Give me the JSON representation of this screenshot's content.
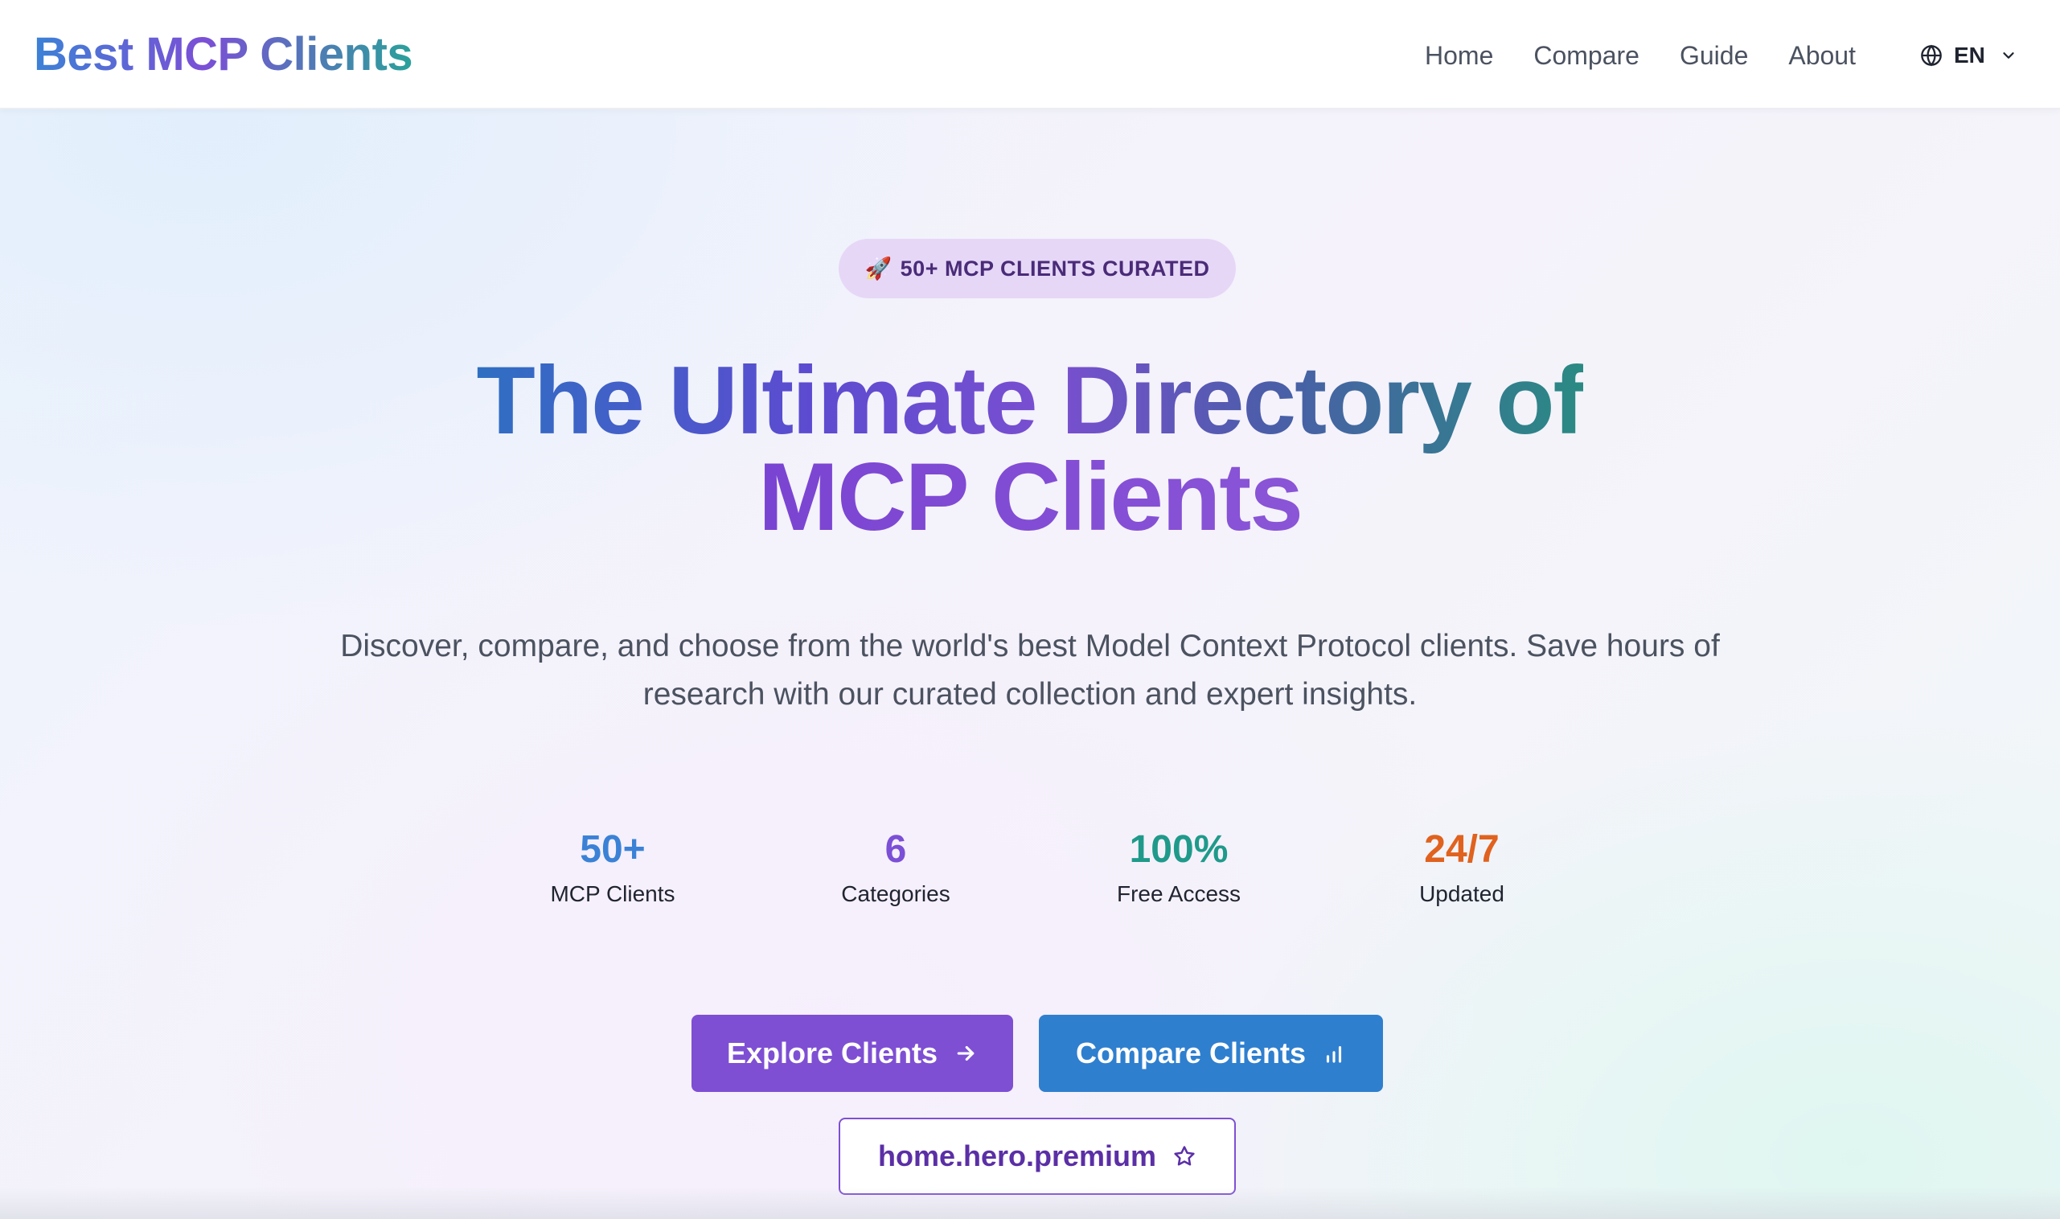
{
  "header": {
    "logo": "Best MCP Clients",
    "nav": [
      {
        "label": "Home"
      },
      {
        "label": "Compare"
      },
      {
        "label": "Guide"
      },
      {
        "label": "About"
      }
    ],
    "language": {
      "code": "EN",
      "icon": "globe-icon"
    }
  },
  "hero": {
    "badge": {
      "emoji": "🚀",
      "text": "50+ MCP CLIENTS CURATED"
    },
    "title_line1": "The Ultimate Directory of",
    "title_line2": "MCP Clients",
    "subtitle": "Discover, compare, and choose from the world's best Model Context Protocol clients. Save hours of research with our curated collection and expert insights.",
    "stats": [
      {
        "value": "50+",
        "label": "MCP Clients",
        "color": "#3b82d6"
      },
      {
        "value": "6",
        "label": "Categories",
        "color": "#7b4fd6"
      },
      {
        "value": "100%",
        "label": "Free Access",
        "color": "#1f9a8a"
      },
      {
        "value": "24/7",
        "label": "Updated",
        "color": "#e0621e"
      }
    ],
    "buttons": {
      "explore": {
        "label": "Explore Clients",
        "icon": "arrow-right-icon"
      },
      "compare": {
        "label": "Compare Clients",
        "icon": "bar-chart-icon"
      },
      "premium": {
        "label": "home.hero.premium",
        "icon": "star-icon"
      }
    }
  },
  "colors": {
    "primary_purple": "#7e4fd3",
    "primary_blue": "#2f7fcf",
    "badge_bg": "#e6d7f7"
  }
}
